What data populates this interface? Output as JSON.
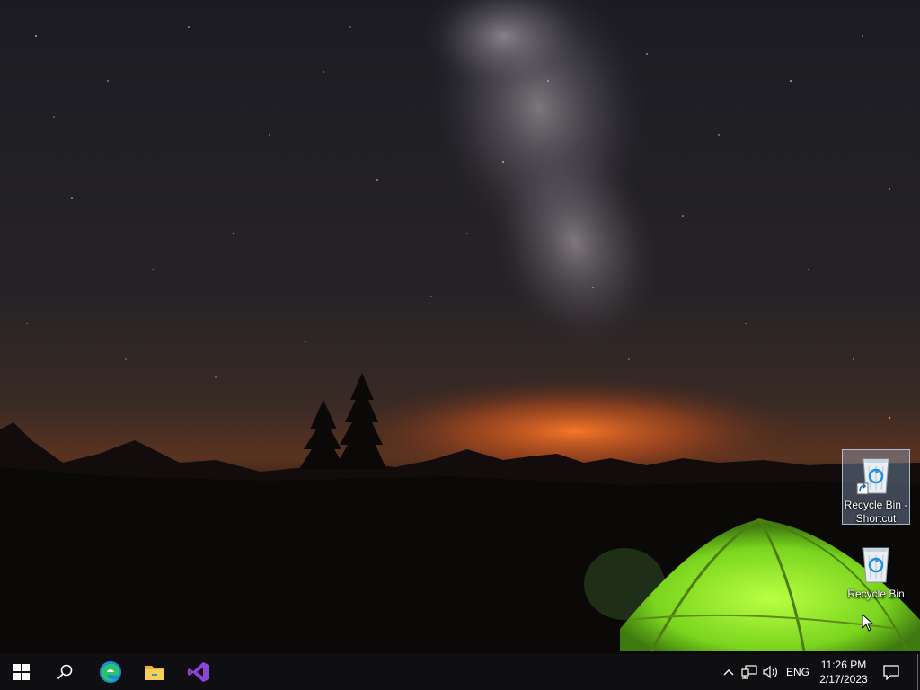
{
  "desktop": {
    "icons": [
      {
        "label": "Recycle Bin - Shortcut",
        "icon": "recycle-bin-icon",
        "shortcut": true,
        "selected": true
      },
      {
        "label": "Recycle Bin",
        "icon": "recycle-bin-icon",
        "shortcut": false,
        "selected": false
      }
    ]
  },
  "taskbar": {
    "pinned": [
      {
        "name": "start",
        "icon": "windows-logo-icon"
      },
      {
        "name": "search",
        "icon": "search-icon"
      },
      {
        "name": "edge",
        "icon": "edge-icon"
      },
      {
        "name": "file-explorer",
        "icon": "folder-icon"
      },
      {
        "name": "visual-studio",
        "icon": "visual-studio-icon"
      }
    ],
    "tray": {
      "language": "ENG",
      "time": "11:26 PM",
      "date": "2/17/2023"
    }
  },
  "colors": {
    "taskbar_bg": "#0f0f12",
    "visual_studio": "#8e44d8",
    "tent_green": "#8fe82a",
    "horizon_glow": "#e0621b"
  }
}
